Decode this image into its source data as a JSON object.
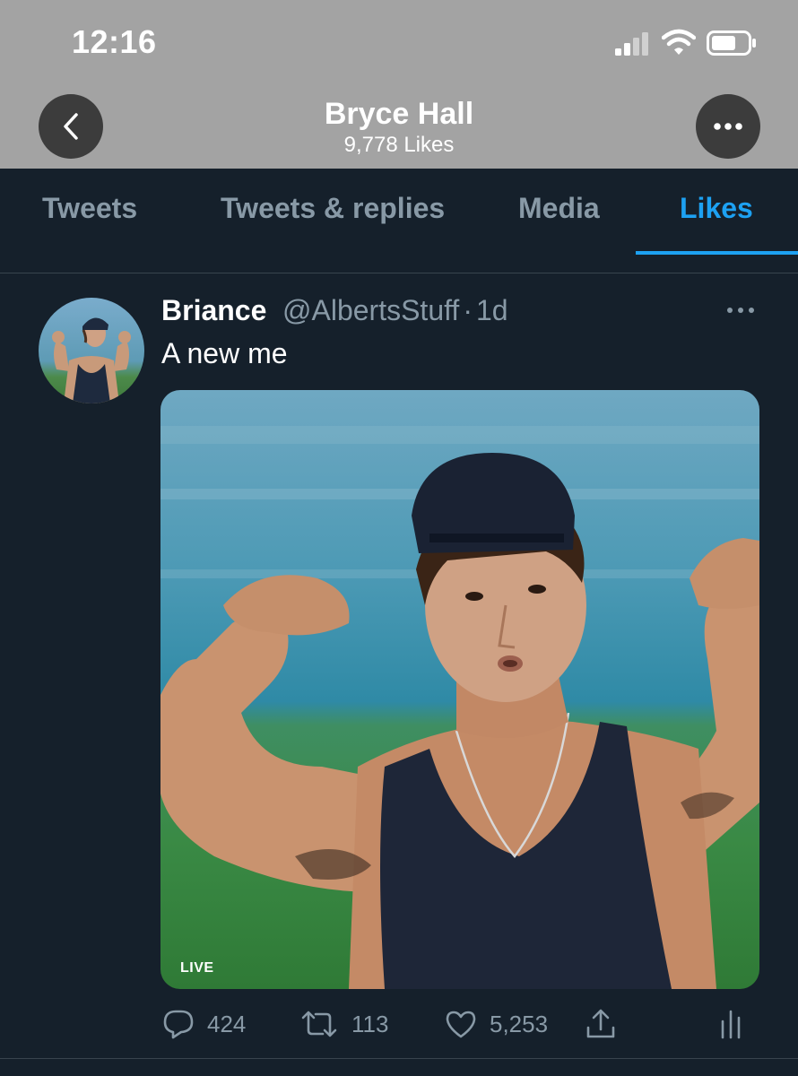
{
  "status": {
    "time": "12:16"
  },
  "nav": {
    "title": "Bryce Hall",
    "subtitle": "9,778 Likes"
  },
  "tabs": [
    {
      "label": "Tweets"
    },
    {
      "label": "Tweets & replies"
    },
    {
      "label": "Media"
    },
    {
      "label": "Likes"
    }
  ],
  "active_tab": "Likes",
  "colors": {
    "accent": "#1da1f2",
    "background": "#15202b",
    "muted": "#8899a6"
  },
  "tweet": {
    "author_name": "Briance",
    "author_handle": "@AlbertsStuff",
    "time_sep": "·",
    "time": "1d",
    "text": "A new me",
    "media_badge": "LIVE",
    "reply_count": "424",
    "retweet_count": "113",
    "like_count": "5,253"
  },
  "icons": [
    "back-icon",
    "more-icon",
    "reply-icon",
    "retweet-icon",
    "like-icon",
    "share-icon",
    "analytics-icon"
  ]
}
